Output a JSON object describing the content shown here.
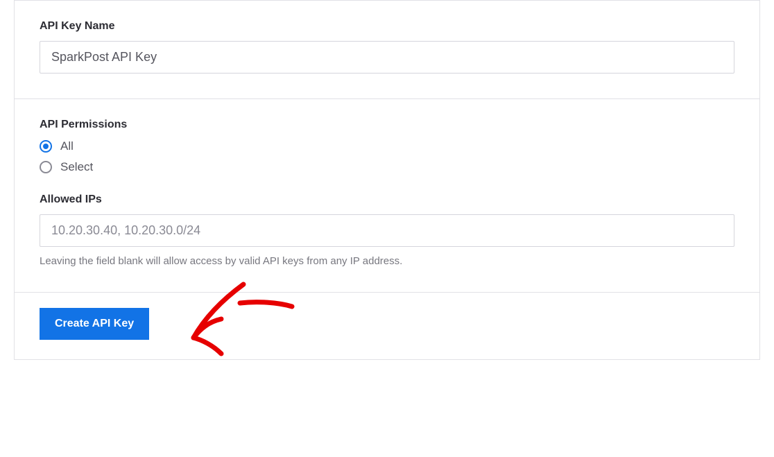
{
  "api_key_name": {
    "label": "API Key Name",
    "value": "SparkPost API Key"
  },
  "permissions": {
    "label": "API Permissions",
    "options": {
      "all": "All",
      "select": "Select"
    },
    "selected": "all"
  },
  "allowed_ips": {
    "label": "Allowed IPs",
    "placeholder": "10.20.30.40, 10.20.30.0/24",
    "value": "",
    "help": "Leaving the field blank will allow access by valid API keys from any IP address."
  },
  "actions": {
    "create": "Create API Key"
  },
  "colors": {
    "primary": "#1273e6",
    "annotation": "#e60000"
  }
}
